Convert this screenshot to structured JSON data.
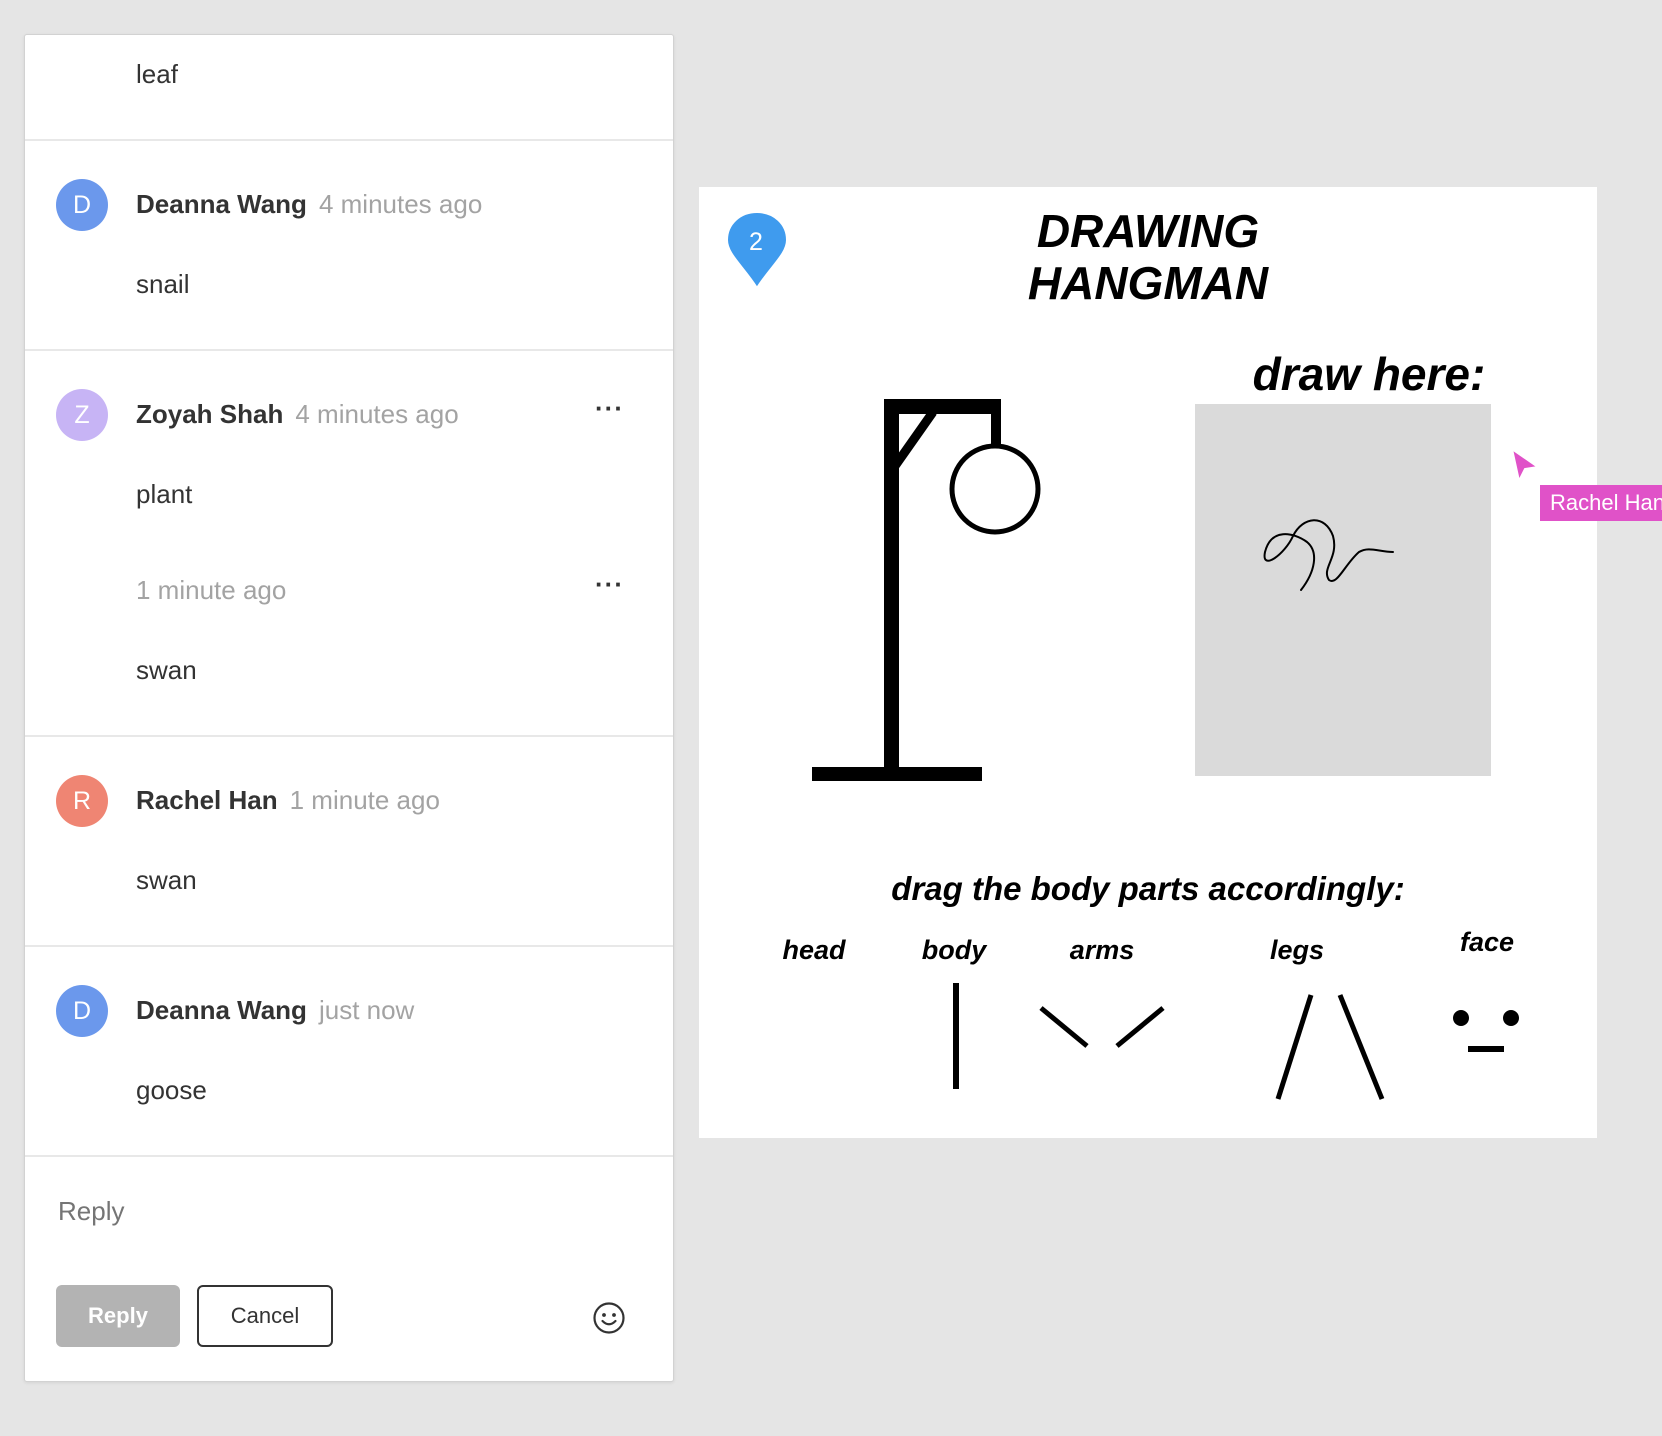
{
  "comments": {
    "first_body": "leaf",
    "items": [
      {
        "initial": "D",
        "color": "#6b98ec",
        "author": "Deanna Wang",
        "time": "4 minutes ago",
        "body": "snail"
      },
      {
        "initial": "Z",
        "color": "#c7b4f5",
        "author": "Zoyah Shah",
        "time": "4 minutes ago",
        "body": "plant"
      },
      {
        "initial": "R",
        "color": "#ef8573",
        "author": "Rachel Han",
        "time": "1 minute ago",
        "body": "swan"
      },
      {
        "initial": "D",
        "color": "#6b98ec",
        "author": "Deanna Wang",
        "time": "just now",
        "body": "goose"
      }
    ],
    "followup": {
      "time": "1 minute ago",
      "body": "swan"
    },
    "more_label": "···"
  },
  "composer": {
    "placeholder": "Reply",
    "reply_label": "Reply",
    "cancel_label": "Cancel",
    "emoji_icon": "smiley-icon"
  },
  "canvas": {
    "title_line1": "DRAWING",
    "title_line2": "HANGMAN",
    "draw_label": "draw here:",
    "drag_label": "drag the body parts accordingly:",
    "parts": [
      "head",
      "body",
      "arms",
      "legs",
      "face"
    ],
    "comment_pin": "2",
    "pin_color": "#3f9bee",
    "cursor_user": "Rachel Han",
    "cursor_color": "#e052c8"
  }
}
